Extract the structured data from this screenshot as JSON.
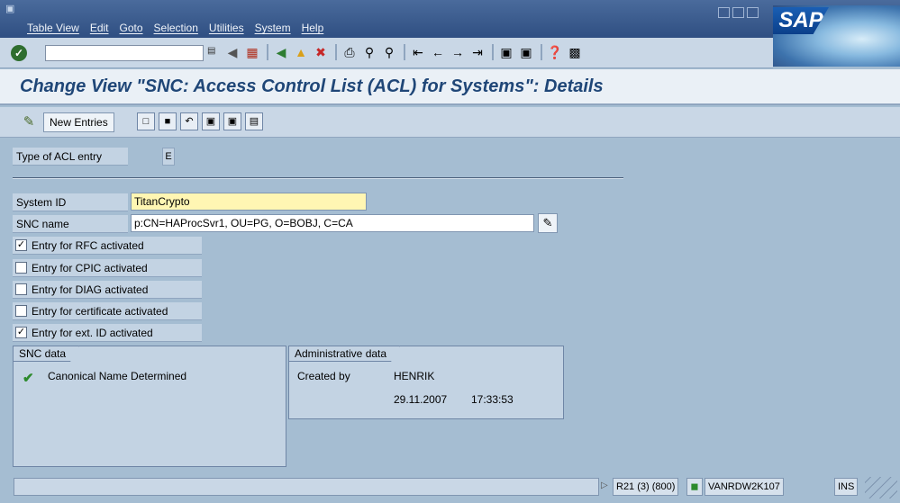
{
  "menu": {
    "items": [
      "Table View",
      "Edit",
      "Goto",
      "Selection",
      "Utilities",
      "System",
      "Help"
    ]
  },
  "brand": {
    "logo_text": "SAP",
    "accent": "#1f4677"
  },
  "toolbar": {
    "icons": [
      "enter-check-icon",
      "command-field",
      "back-icon",
      "save-icon",
      "back-green-icon",
      "exit-icon",
      "cancel-icon",
      "print-icon",
      "find-icon",
      "find-next-icon",
      "first-page-icon",
      "prev-page-icon",
      "next-page-icon",
      "last-page-icon",
      "create-session-icon",
      "shortcut-icon",
      "help-icon",
      "layout-icon"
    ]
  },
  "title": "Change View \"SNC: Access Control List (ACL) for Systems\": Details",
  "app_toolbar": {
    "new_entries": "New Entries"
  },
  "form": {
    "acl_type_label": "Type of ACL entry",
    "acl_type_value": "E",
    "system_id_label": "System ID",
    "system_id_value": "TitanCrypto",
    "snc_name_label": "SNC name",
    "snc_name_value": "p:CN=HAProcSvr1, OU=PG, O=BOBJ, C=CA",
    "checkboxes": [
      {
        "label": "Entry for RFC activated",
        "checked": true
      },
      {
        "label": "Entry for CPIC activated",
        "checked": false
      },
      {
        "label": "Entry for DIAG activated",
        "checked": false
      },
      {
        "label": "Entry for certificate activated",
        "checked": false
      },
      {
        "label": "Entry for ext. ID activated",
        "checked": true
      }
    ]
  },
  "snc_data": {
    "title": "SNC data",
    "status": "Canonical Name Determined"
  },
  "admin_data": {
    "title": "Administrative data",
    "created_by_label": "Created by",
    "created_by_value": "HENRIK",
    "date": "29.11.2007",
    "time": "17:33:53"
  },
  "statusbar": {
    "system": "R21 (3) (800)",
    "server": "VANRDW2K107",
    "mode": "INS"
  }
}
